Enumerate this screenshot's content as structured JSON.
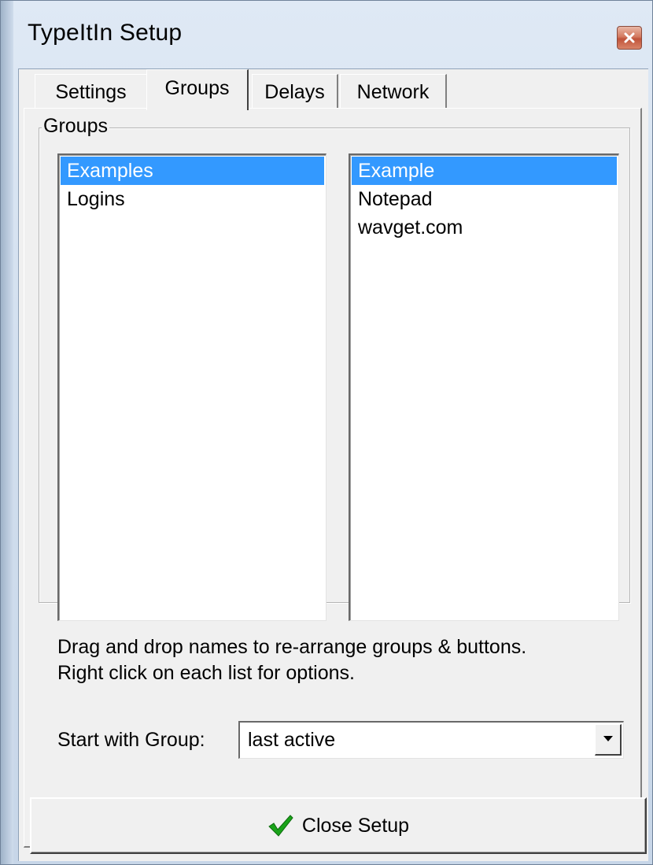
{
  "window": {
    "title": "TypeItIn Setup",
    "close_icon": "close-icon"
  },
  "tabs": [
    {
      "label": "Settings",
      "active": false
    },
    {
      "label": "Groups",
      "active": true
    },
    {
      "label": "Delays",
      "active": false
    },
    {
      "label": "Network",
      "active": false
    }
  ],
  "groups_panel": {
    "groupbox_label": "Groups",
    "groups_list": [
      {
        "label": "Examples",
        "selected": true
      },
      {
        "label": "Logins",
        "selected": false
      }
    ],
    "buttons_list": [
      {
        "label": "Example",
        "selected": true
      },
      {
        "label": "Notepad",
        "selected": false
      },
      {
        "label": "wavget.com",
        "selected": false
      }
    ],
    "hint_line_1": "Drag and drop names to re-arrange groups & buttons.",
    "hint_line_2": "Right click on each list for options.",
    "start_with_group_label": "Start with Group:",
    "start_with_group_value": "last active"
  },
  "footer": {
    "close_setup_label": "Close Setup",
    "close_setup_icon": "check-icon"
  },
  "colors": {
    "selection": "#3399ff",
    "check": "#1aa31a",
    "close_button": "#c0533a"
  }
}
